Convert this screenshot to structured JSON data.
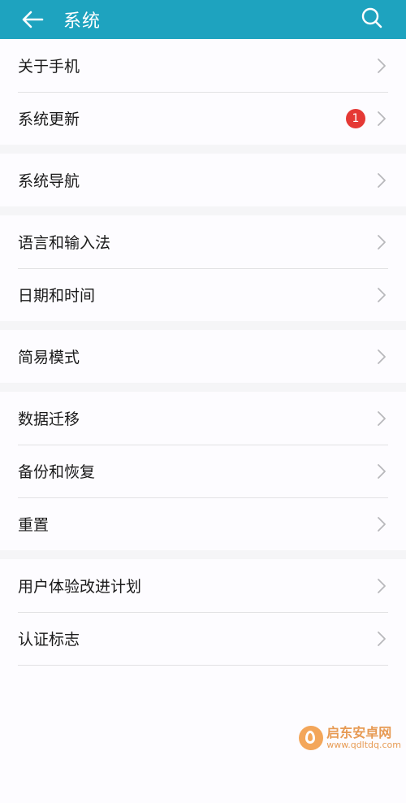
{
  "header": {
    "title": "系统",
    "background_color": "#1ea3bf",
    "back_icon": "arrow-left-icon",
    "search_icon": "search-icon"
  },
  "groups": [
    {
      "items": [
        {
          "label": "关于手机"
        },
        {
          "label": "系统更新",
          "badge": "1"
        }
      ]
    },
    {
      "items": [
        {
          "label": "系统导航"
        }
      ]
    },
    {
      "items": [
        {
          "label": "语言和输入法"
        },
        {
          "label": "日期和时间"
        }
      ]
    },
    {
      "items": [
        {
          "label": "简易模式"
        }
      ]
    },
    {
      "items": [
        {
          "label": "数据迁移"
        },
        {
          "label": "备份和恢复"
        },
        {
          "label": "重置"
        }
      ]
    },
    {
      "items": [
        {
          "label": "用户体验改进计划"
        },
        {
          "label": "认证标志"
        }
      ]
    }
  ],
  "badge_color": "#e53935",
  "watermark": {
    "title": "启东安卓网",
    "url": "www.qdltdq.com"
  }
}
